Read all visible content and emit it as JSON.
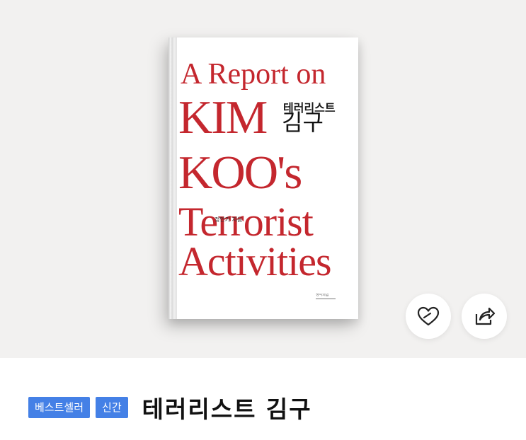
{
  "cover": {
    "title_line1": "A Report on",
    "title_line2": "KIM",
    "title_line3": "KOO's",
    "title_line4": "Terrorist",
    "title_line5": "Activities",
    "korean_subtitle": "테러리스트",
    "korean_title": "김구",
    "author": "정안기 지음",
    "publisher": "생각의힘",
    "accent_color": "#c4272e"
  },
  "actions": {
    "like_icon": "heart-outline-icon",
    "share_icon": "share-icon"
  },
  "product": {
    "badges": [
      "베스트셀러",
      "신간"
    ],
    "title": "테러리스트 김구",
    "badge_color": "#4480e6"
  }
}
